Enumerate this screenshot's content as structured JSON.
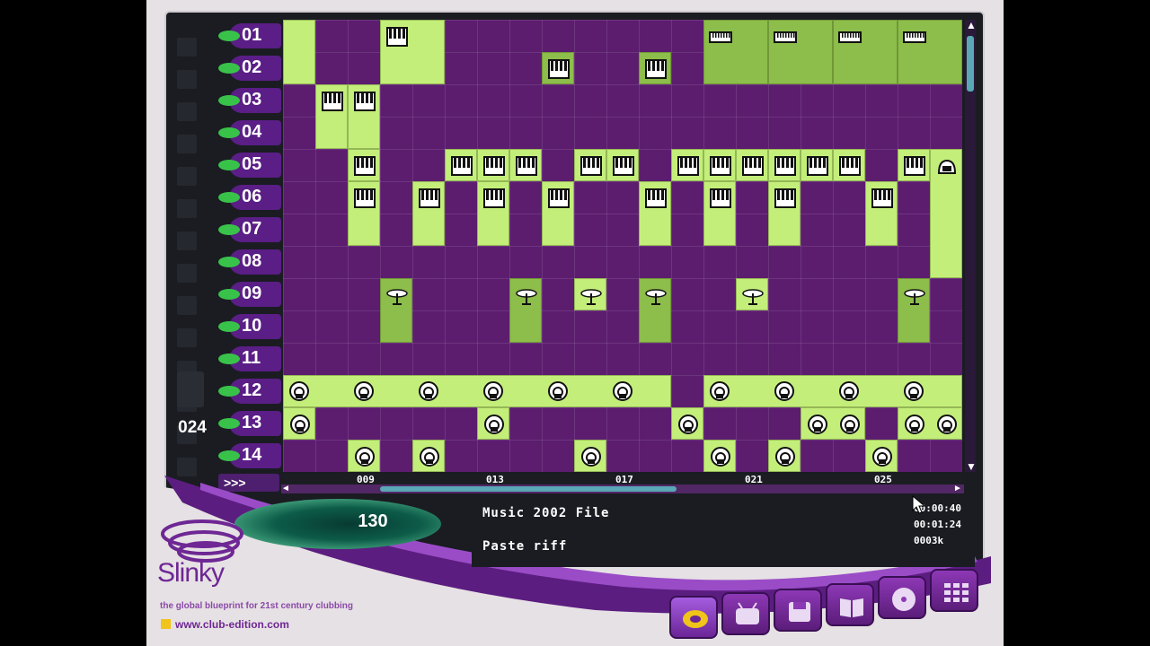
{
  "app": {
    "brand_name": "Slinky",
    "tagline": "the global blueprint for 21st century clubbing",
    "url": "www.club-edition.com"
  },
  "tracks": [
    "01",
    "02",
    "03",
    "04",
    "05",
    "06",
    "07",
    "08",
    "09",
    "10",
    "11",
    "12",
    "13",
    "14"
  ],
  "step_count": "024",
  "ff_label": ">>>",
  "bar_markers": [
    "009",
    "013",
    "017",
    "021",
    "025"
  ],
  "tempo": "130",
  "song_name": "Music 2002 File",
  "status_message": "Paste riff",
  "readouts": {
    "elapsed": "00:00:40",
    "total": "00:01:24",
    "memory": "0003k"
  },
  "colors": {
    "grid_bg": "#5c1d6f",
    "block_bright": "#c3ee7a",
    "block_dark": "#8dbd4a",
    "accent_purple": "#6e2794",
    "track_leaf": "#39c24a"
  },
  "blocks": [
    {
      "col": 0,
      "row": 0,
      "len": 1,
      "h": 2,
      "tone": "bright",
      "icon": "none"
    },
    {
      "col": 3,
      "row": 0,
      "len": 2,
      "h": 2,
      "tone": "bright",
      "icon": "keyboard"
    },
    {
      "col": 13,
      "row": 0,
      "len": 2,
      "h": 2,
      "tone": "dark",
      "icon": "synth"
    },
    {
      "col": 15,
      "row": 0,
      "len": 2,
      "h": 2,
      "tone": "dark",
      "icon": "synth"
    },
    {
      "col": 17,
      "row": 0,
      "len": 2,
      "h": 2,
      "tone": "dark",
      "icon": "synth"
    },
    {
      "col": 19,
      "row": 0,
      "len": 2,
      "h": 2,
      "tone": "dark",
      "icon": "synth"
    },
    {
      "col": 8,
      "row": 1,
      "len": 1,
      "h": 1,
      "tone": "dark",
      "icon": "keyboard"
    },
    {
      "col": 11,
      "row": 1,
      "len": 1,
      "h": 1,
      "tone": "dark",
      "icon": "keyboard"
    },
    {
      "col": 1,
      "row": 2,
      "len": 1,
      "h": 2,
      "tone": "bright",
      "icon": "keyboard"
    },
    {
      "col": 2,
      "row": 2,
      "len": 1,
      "h": 2,
      "tone": "bright",
      "icon": "keyboard"
    },
    {
      "col": 2,
      "row": 4,
      "len": 1,
      "h": 1,
      "tone": "bright",
      "icon": "keyboard"
    },
    {
      "col": 5,
      "row": 4,
      "len": 1,
      "h": 1,
      "tone": "bright",
      "icon": "keyboard"
    },
    {
      "col": 6,
      "row": 4,
      "len": 1,
      "h": 1,
      "tone": "bright",
      "icon": "keyboard"
    },
    {
      "col": 7,
      "row": 4,
      "len": 1,
      "h": 1,
      "tone": "bright",
      "icon": "keyboard"
    },
    {
      "col": 9,
      "row": 4,
      "len": 1,
      "h": 1,
      "tone": "bright",
      "icon": "keyboard"
    },
    {
      "col": 10,
      "row": 4,
      "len": 1,
      "h": 1,
      "tone": "bright",
      "icon": "keyboard"
    },
    {
      "col": 12,
      "row": 4,
      "len": 1,
      "h": 1,
      "tone": "bright",
      "icon": "keyboard"
    },
    {
      "col": 13,
      "row": 4,
      "len": 1,
      "h": 1,
      "tone": "bright",
      "icon": "keyboard"
    },
    {
      "col": 14,
      "row": 4,
      "len": 1,
      "h": 1,
      "tone": "bright",
      "icon": "keyboard"
    },
    {
      "col": 15,
      "row": 4,
      "len": 1,
      "h": 1,
      "tone": "bright",
      "icon": "keyboard"
    },
    {
      "col": 16,
      "row": 4,
      "len": 1,
      "h": 1,
      "tone": "bright",
      "icon": "keyboard"
    },
    {
      "col": 17,
      "row": 4,
      "len": 1,
      "h": 1,
      "tone": "bright",
      "icon": "keyboard"
    },
    {
      "col": 19,
      "row": 4,
      "len": 1,
      "h": 1,
      "tone": "bright",
      "icon": "keyboard"
    },
    {
      "col": 20,
      "row": 4,
      "len": 1,
      "h": 4,
      "tone": "bright",
      "icon": "vocal"
    },
    {
      "col": 2,
      "row": 5,
      "len": 1,
      "h": 2,
      "tone": "bright",
      "icon": "keyboard"
    },
    {
      "col": 4,
      "row": 5,
      "len": 1,
      "h": 2,
      "tone": "bright",
      "icon": "keyboard"
    },
    {
      "col": 6,
      "row": 5,
      "len": 1,
      "h": 2,
      "tone": "bright",
      "icon": "keyboard"
    },
    {
      "col": 8,
      "row": 5,
      "len": 1,
      "h": 2,
      "tone": "bright",
      "icon": "keyboard"
    },
    {
      "col": 11,
      "row": 5,
      "len": 1,
      "h": 2,
      "tone": "bright",
      "icon": "keyboard"
    },
    {
      "col": 13,
      "row": 5,
      "len": 1,
      "h": 2,
      "tone": "bright",
      "icon": "keyboard"
    },
    {
      "col": 15,
      "row": 5,
      "len": 1,
      "h": 2,
      "tone": "bright",
      "icon": "keyboard"
    },
    {
      "col": 18,
      "row": 5,
      "len": 1,
      "h": 2,
      "tone": "bright",
      "icon": "keyboard"
    },
    {
      "col": 3,
      "row": 8,
      "len": 1,
      "h": 2,
      "tone": "dark",
      "icon": "cymbal"
    },
    {
      "col": 7,
      "row": 8,
      "len": 1,
      "h": 2,
      "tone": "dark",
      "icon": "cymbal"
    },
    {
      "col": 9,
      "row": 8,
      "len": 1,
      "h": 1,
      "tone": "bright",
      "icon": "cymbal"
    },
    {
      "col": 11,
      "row": 8,
      "len": 1,
      "h": 2,
      "tone": "dark",
      "icon": "cymbal"
    },
    {
      "col": 14,
      "row": 8,
      "len": 1,
      "h": 1,
      "tone": "bright",
      "icon": "cymbal"
    },
    {
      "col": 19,
      "row": 8,
      "len": 1,
      "h": 2,
      "tone": "dark",
      "icon": "cymbal"
    },
    {
      "col": 0,
      "row": 11,
      "len": 12,
      "h": 1,
      "tone": "bright",
      "icon": "none"
    },
    {
      "col": 13,
      "row": 11,
      "len": 8,
      "h": 1,
      "tone": "bright",
      "icon": "none"
    },
    {
      "col": 0,
      "row": 12,
      "len": 1,
      "h": 1,
      "tone": "bright",
      "icon": "drum"
    },
    {
      "col": 6,
      "row": 12,
      "len": 1,
      "h": 1,
      "tone": "bright",
      "icon": "drum"
    },
    {
      "col": 12,
      "row": 12,
      "len": 1,
      "h": 1,
      "tone": "bright",
      "icon": "drum"
    },
    {
      "col": 16,
      "row": 12,
      "len": 2,
      "h": 1,
      "tone": "bright",
      "icon": "drum"
    },
    {
      "col": 19,
      "row": 12,
      "len": 2,
      "h": 1,
      "tone": "bright",
      "icon": "drum"
    },
    {
      "col": 2,
      "row": 13,
      "len": 1,
      "h": 1,
      "tone": "bright",
      "icon": "drum"
    },
    {
      "col": 4,
      "row": 13,
      "len": 1,
      "h": 1,
      "tone": "bright",
      "icon": "drum"
    },
    {
      "col": 9,
      "row": 13,
      "len": 1,
      "h": 1,
      "tone": "bright",
      "icon": "drum"
    },
    {
      "col": 13,
      "row": 13,
      "len": 1,
      "h": 1,
      "tone": "bright",
      "icon": "drum"
    },
    {
      "col": 15,
      "row": 13,
      "len": 1,
      "h": 1,
      "tone": "bright",
      "icon": "drum"
    },
    {
      "col": 18,
      "row": 13,
      "len": 1,
      "h": 1,
      "tone": "bright",
      "icon": "drum"
    }
  ],
  "row12_drum_cols": [
    0,
    2,
    4,
    6,
    8,
    10,
    13,
    15,
    17,
    19
  ]
}
